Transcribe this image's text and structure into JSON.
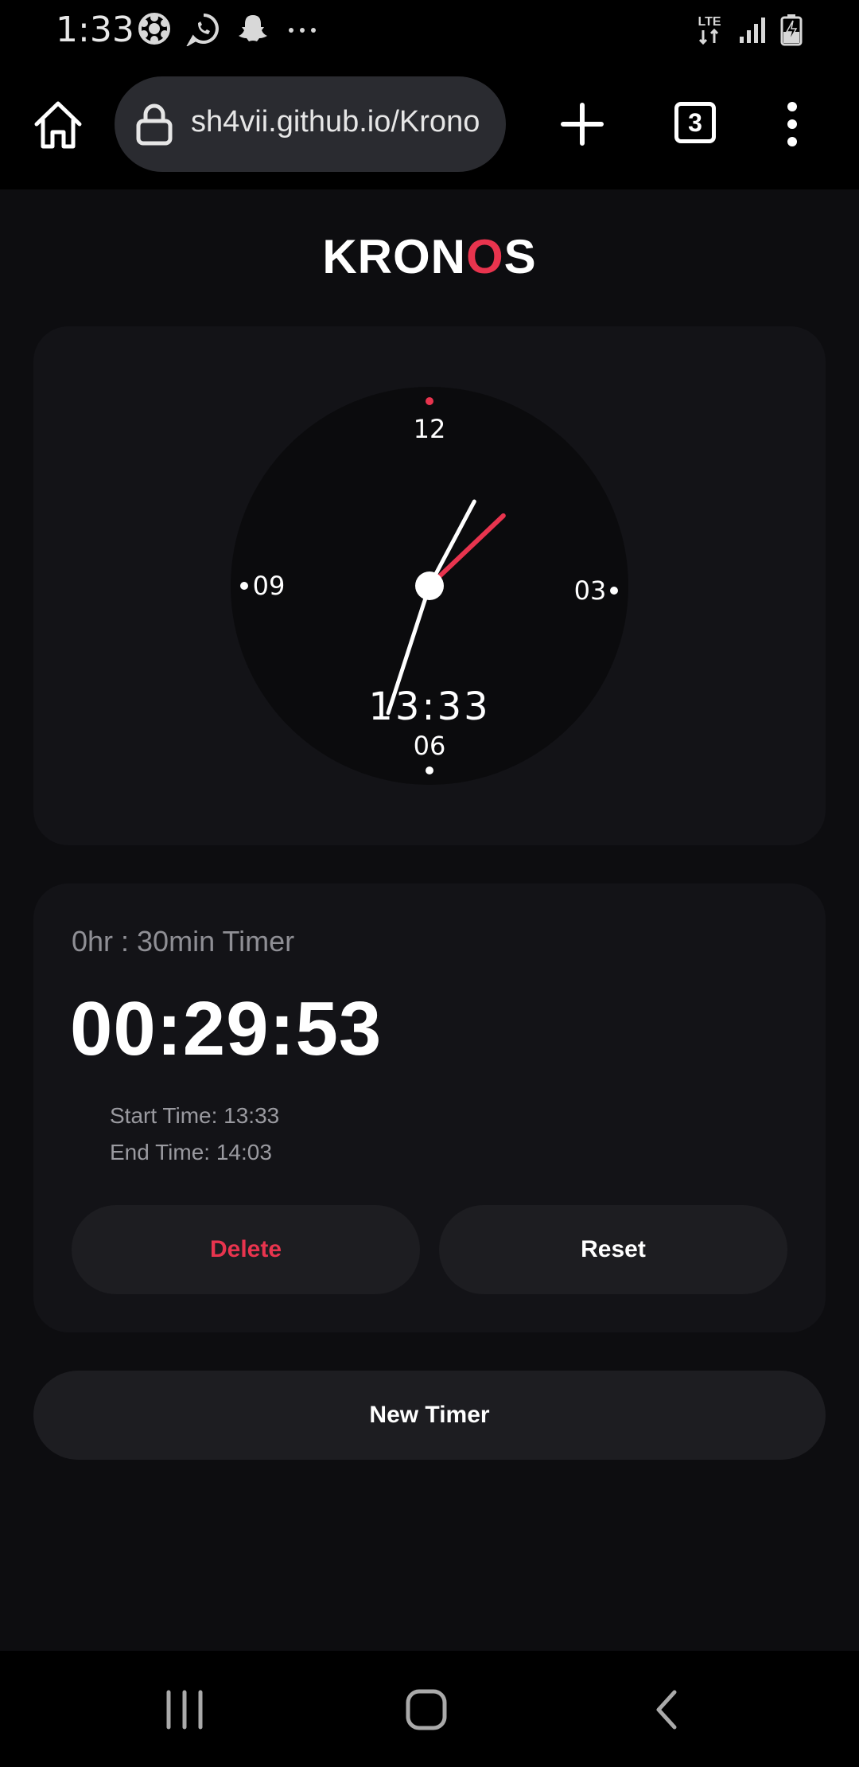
{
  "status_bar": {
    "time": "1:33",
    "notification_icons": [
      "asterisk-badge-icon",
      "whatsapp-icon",
      "snapchat-icon",
      "more-dots-icon"
    ],
    "network_label": "LTE",
    "right_icons": [
      "lte-icon",
      "signal-icon",
      "battery-charging-icon"
    ]
  },
  "browser": {
    "url": "sh4vii.github.io/Krono",
    "tab_count": "3"
  },
  "app": {
    "title_prefix": "KRON",
    "title_accent": "O",
    "title_suffix": "S",
    "accent_color": "#e8344e"
  },
  "clock": {
    "label_12": "12",
    "label_03": "03",
    "label_06": "06",
    "label_09": "09",
    "digital_time": "13:33",
    "hour": 13,
    "minute": 33
  },
  "timer": {
    "label": "0hr : 30min Timer",
    "remaining": "00:29:53",
    "start_time": "Start Time: 13:33",
    "end_time": "End Time: 14:03",
    "delete_label": "Delete",
    "reset_label": "Reset"
  },
  "new_timer_label": "New Timer",
  "nav_bar": {
    "icons": [
      "recent-apps-icon",
      "home-icon",
      "back-icon"
    ]
  }
}
